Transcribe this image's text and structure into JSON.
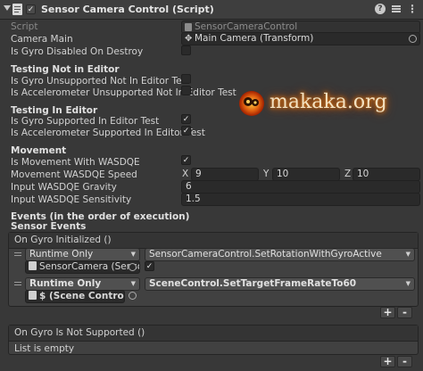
{
  "header": {
    "title": "Sensor Camera Control (Script)",
    "enabled": "✓"
  },
  "fields": {
    "script_label": "Script",
    "script_value": "SensorCameraControl",
    "camera_main_label": "Camera Main",
    "camera_main_value": "Main Camera (Transform)",
    "gyro_disabled_label": "Is Gyro Disabled On Destroy"
  },
  "sections": {
    "testing_not_in_editor": "Testing Not in Editor",
    "gyro_unsupported_label": "Is Gyro Unsupported Not In Editor Test",
    "accel_unsupported_label": "Is Accelerometer Unsupported Not In Editor Test",
    "testing_in_editor": "Testing In Editor",
    "gyro_supported_label": "Is Gyro Supported In Editor Test",
    "accel_supported_label": "Is Accelerometer Supported In Editor Test",
    "movement": "Movement",
    "wasdqe_label": "Is Movement With WASDQE",
    "speed_label": "Movement WASDQE Speed",
    "speed_x_label": "X",
    "speed_x": "9",
    "speed_y_label": "Y",
    "speed_y": "10",
    "speed_z_label": "Z",
    "speed_z": "10",
    "gravity_label": "Input WASDQE Gravity",
    "gravity": "6",
    "sensitivity_label": "Input WASDQE Sensitivity",
    "sensitivity": "1.5",
    "events_heading": "Events (in the order of execution)",
    "sensor_events": "Sensor Events"
  },
  "checks": {
    "checked": "✓"
  },
  "on_gyro_initialized": {
    "title": "On Gyro Initialized ()",
    "rows": [
      {
        "mode": "Runtime Only",
        "function": "SensorCameraControl.SetRotationWithGyroActive",
        "object": "SensorCamera (Sensor Cam",
        "arg": "✓"
      },
      {
        "mode": "Runtime Only",
        "function": "SceneControl.SetTargetFrameRateTo60",
        "object": "$ (Scene Control)"
      }
    ]
  },
  "on_gyro_not_supported": {
    "title": "On Gyro Is Not Supported ()",
    "empty_text": "List is empty"
  },
  "buttons": {
    "add": "+",
    "remove": "-",
    "help": "?",
    "more": "⋮"
  },
  "watermark": {
    "text": "makaka.org"
  },
  "colors": {
    "background": "#383838",
    "watermark_text": "#f0e0c0",
    "watermark_glow": "#e08010"
  }
}
